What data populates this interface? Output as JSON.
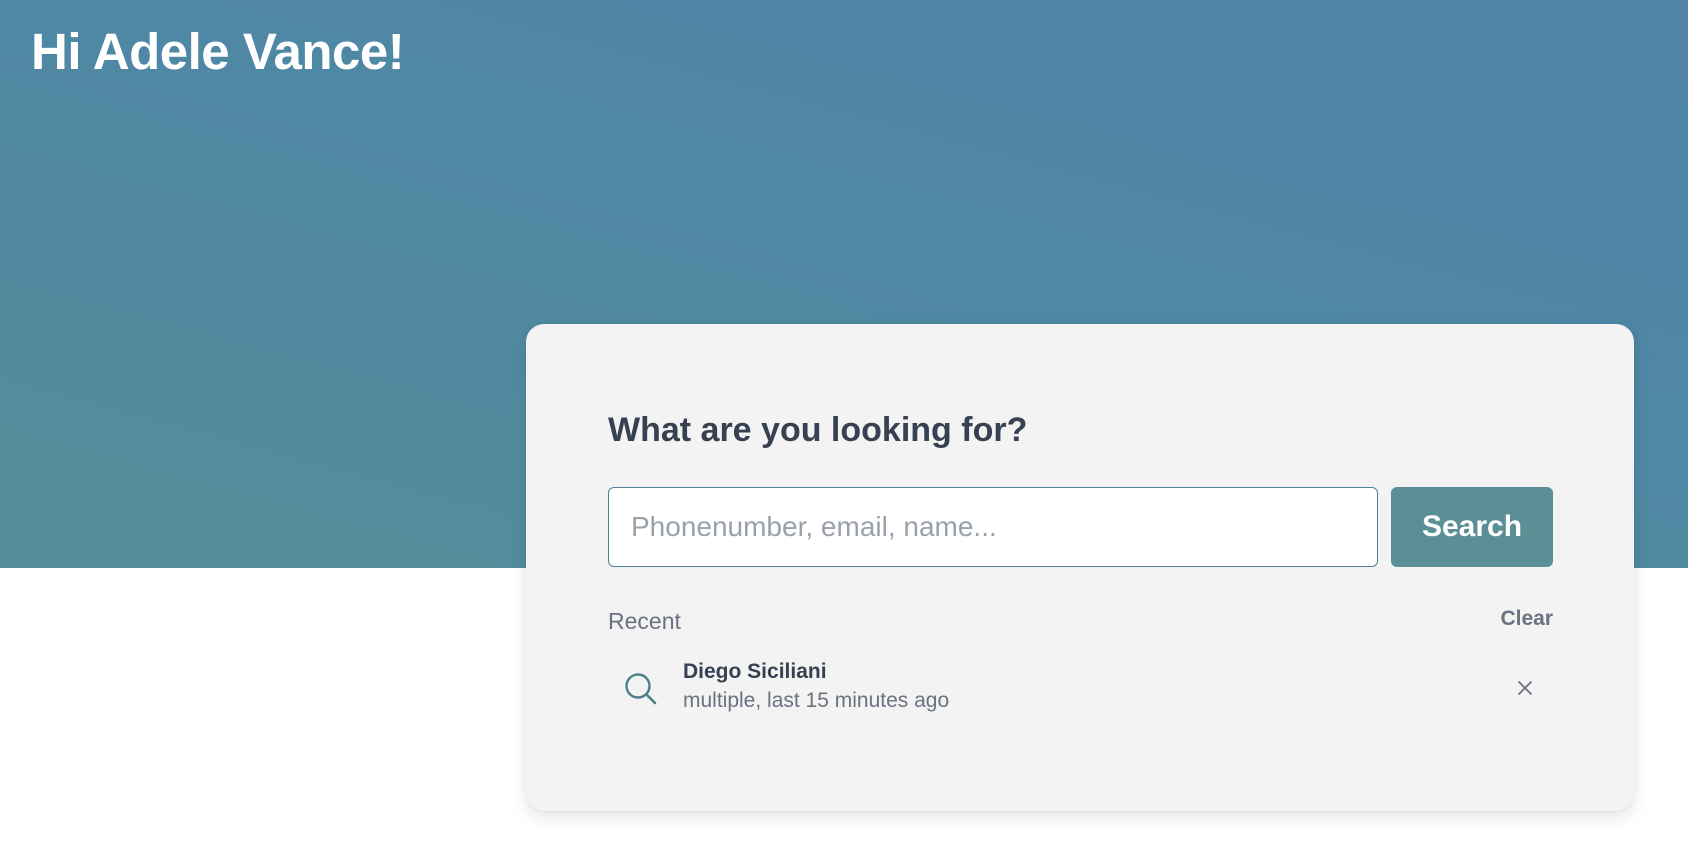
{
  "header": {
    "greeting": "Hi Adele Vance!"
  },
  "search_card": {
    "title": "What are you looking for?",
    "input": {
      "placeholder": "Phonenumber, email, name...",
      "value": ""
    },
    "search_button_label": "Search",
    "recent_label": "Recent",
    "clear_label": "Clear",
    "recent_items": [
      {
        "name": "Diego Siciliani",
        "meta": "multiple, last 15 minutes ago",
        "icon": "search-icon",
        "remove_icon": "close-icon"
      }
    ]
  },
  "colors": {
    "hero_gradient_start": "#5183a6",
    "hero_gradient_end": "#558d99",
    "accent": "#5a8f95",
    "input_border": "#4d8494",
    "card_background": "#f3f3f4",
    "title_text": "#374151",
    "muted_text": "#6b7280"
  }
}
